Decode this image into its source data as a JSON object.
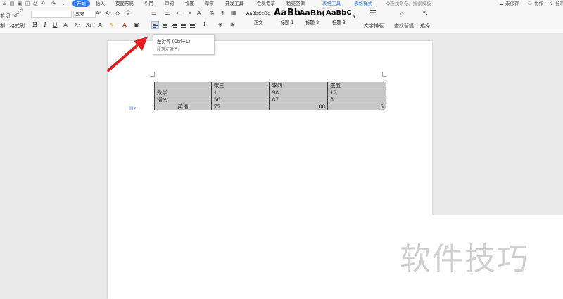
{
  "menubar": {
    "tabs": [
      {
        "label": "开始",
        "active": true
      },
      {
        "label": "插入"
      },
      {
        "label": "页面布局"
      },
      {
        "label": "引用"
      },
      {
        "label": "审阅"
      },
      {
        "label": "视图"
      },
      {
        "label": "章节"
      },
      {
        "label": "开发工具"
      },
      {
        "label": "会员专享"
      },
      {
        "label": "稻壳资源"
      },
      {
        "label": "表格工具",
        "context": true
      },
      {
        "label": "表格样式",
        "context": true
      }
    ],
    "search_text": "Q查找命令、搜索模板",
    "save_status": "未保存",
    "collab": "协作",
    "share": "分享",
    "accent_color": "#2f7cf6"
  },
  "ribbon": {
    "cut_label": "剪切",
    "format_painter_label": "格式刷",
    "font_size": "五号",
    "styles": [
      {
        "sample": "AaBbCcDd",
        "label": "正文"
      },
      {
        "sample": "AaBb",
        "label": "标题 1"
      },
      {
        "sample": "AaBb(",
        "label": "标题 2"
      },
      {
        "sample": "AaBbC",
        "label": "标题 3"
      }
    ],
    "text_layout_label": "文字排版",
    "find_replace_label": "查找替换",
    "select_label": "选择"
  },
  "tooltip": {
    "title": "左对齐 (Ctrl+L)",
    "description": "段落左对齐。"
  },
  "table": {
    "rows": [
      [
        "",
        "张三",
        "李四",
        "王五"
      ],
      [
        "数学",
        "1",
        "98",
        "12"
      ],
      [
        "语文",
        "56",
        "87",
        "3"
      ],
      [
        "英语",
        "77",
        "88",
        "5"
      ]
    ]
  },
  "watermark": "软件技巧"
}
